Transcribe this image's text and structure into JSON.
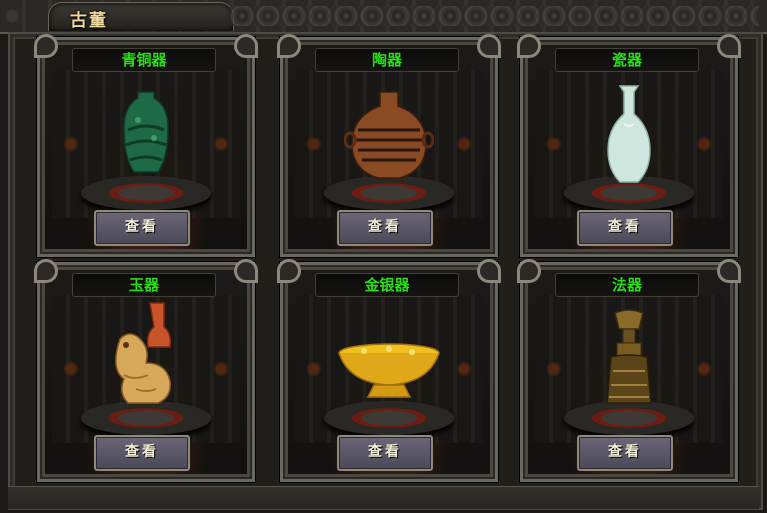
{
  "window": {
    "title": "古董"
  },
  "items": [
    {
      "name": "青铜器",
      "button": "查看",
      "artifact": "bronze-vase-icon"
    },
    {
      "name": "陶器",
      "button": "查看",
      "artifact": "pottery-jar-icon"
    },
    {
      "name": "瓷器",
      "button": "查看",
      "artifact": "porcelain-vase-icon"
    },
    {
      "name": "玉器",
      "button": "查看",
      "artifact": "jade-dragon-icon"
    },
    {
      "name": "金银器",
      "button": "查看",
      "artifact": "gold-bowl-icon"
    },
    {
      "name": "法器",
      "button": "查看",
      "artifact": "ritual-vajra-icon"
    }
  ],
  "colors": {
    "name_text": "#26e00f",
    "title_text": "#f1d9a0",
    "button_bg": "#5a5666"
  }
}
